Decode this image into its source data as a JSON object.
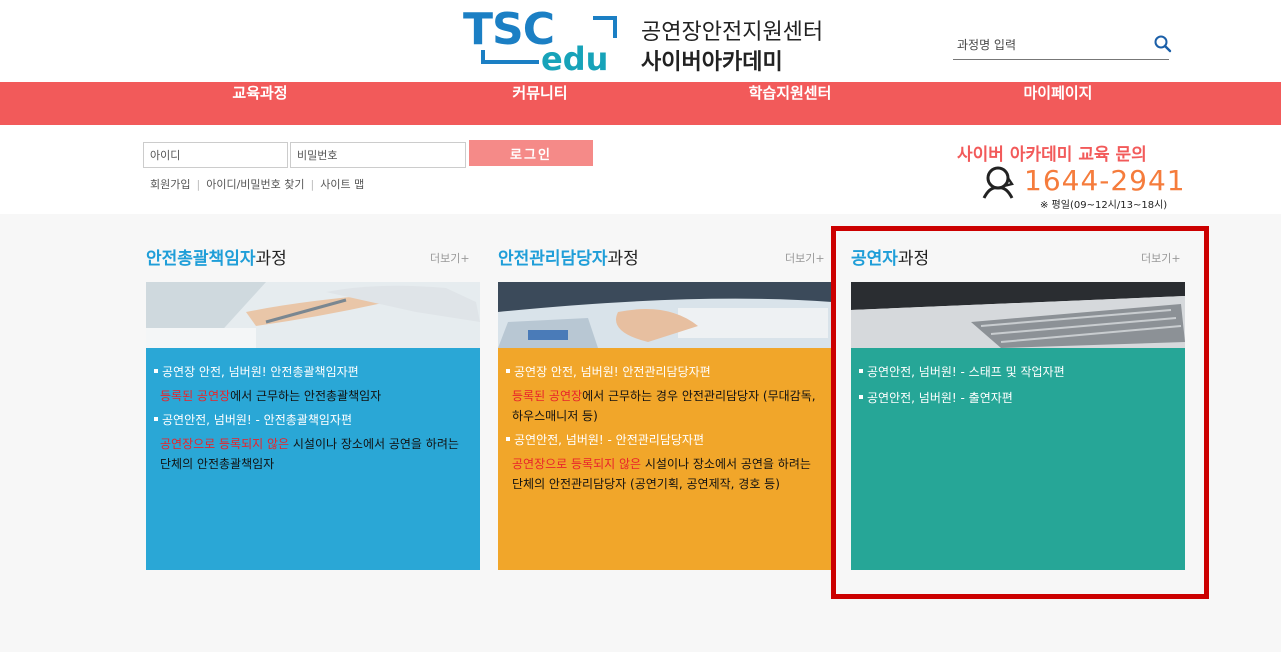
{
  "header": {
    "logo_tsc": "TSC",
    "logo_edu": "edu",
    "title_line1": "공연장안전지원센터",
    "title_line2": "사이버아카데미",
    "search_placeholder": "과정명 입력"
  },
  "nav": {
    "items": [
      {
        "label": "교육과정"
      },
      {
        "label": "커뮤니티"
      },
      {
        "label": "학습지원센터"
      },
      {
        "label": "마이페이지"
      }
    ]
  },
  "login": {
    "id_placeholder": "아이디",
    "pw_placeholder": "비밀번호",
    "button_label": "로그인",
    "links": [
      "회원가입",
      "아이디/비밀번호 찾기",
      "사이트 맵"
    ]
  },
  "inquiry": {
    "title": "사이버 아카데미 교육 문의",
    "phone": "1644-2941",
    "hours": "※ 평일(09~12시/13~18시)"
  },
  "cards": [
    {
      "title_highlight": "안전총괄책임자",
      "title_rest": "과정",
      "more": "더보기+",
      "bg": "#2aa7d6",
      "items": [
        {
          "text": "공연장 안전, 넘버원! 안전총괄책임자편"
        },
        {
          "red": "등록된 공연장",
          "text": "에서 근무하는 안전총괄책임자",
          "dark": true
        },
        {
          "text": "공연안전, 넘버원! - 안전총괄책임자편"
        },
        {
          "red": "공연장으로 등록되지 않은",
          "text": " 시설이나 장소에서 공연을 하려는 단체의 안전총괄책임자",
          "dark": true
        }
      ]
    },
    {
      "title_highlight": "안전관리담당자",
      "title_rest": "과정",
      "more": "더보기+",
      "bg": "#f1a62a",
      "items": [
        {
          "text": "공연장 안전, 넘버원! 안전관리담당자편"
        },
        {
          "red": "등록된 공연장",
          "text": "에서 근무하는 경우 안전관리담당자 (무대감독, 하우스매니저 등)",
          "dark": true
        },
        {
          "text": "공연안전, 넘버원! - 안전관리담당자편"
        },
        {
          "red": "공연장으로 등록되지 않은",
          "text": " 시설이나 장소에서 공연을 하려는 단체의 안전관리담당자 (공연기획, 공연제작, 경호 등)",
          "dark": true
        }
      ]
    },
    {
      "title_highlight": "공연자",
      "title_rest": "과정",
      "more": "더보기+",
      "bg": "#26a697",
      "items": [
        {
          "text": "공연안전, 넘버원! - 스태프 및 작업자편"
        },
        {
          "text": "공연안전, 넘버원! - 출연자편"
        }
      ]
    }
  ],
  "colors": {
    "nav_bg": "#f25a5a",
    "brand_blue": "#1b7fc4",
    "highlight_border": "#cc0000"
  },
  "icons": [
    "search-icon",
    "headset-icon"
  ]
}
